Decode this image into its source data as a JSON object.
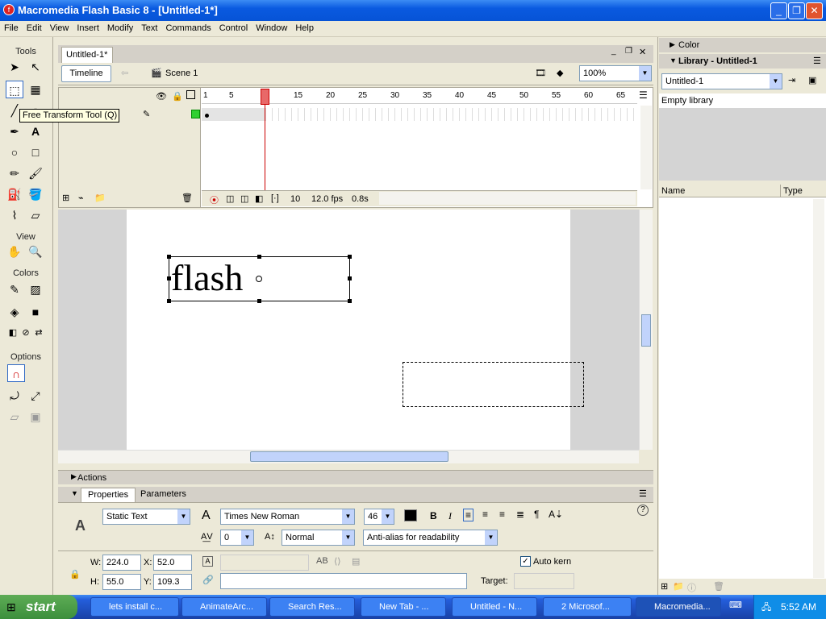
{
  "window": {
    "title": "Macromedia Flash Basic 8 - [Untitled-1*]"
  },
  "menu": [
    "File",
    "Edit",
    "View",
    "Insert",
    "Modify",
    "Text",
    "Commands",
    "Control",
    "Window",
    "Help"
  ],
  "toolbox": {
    "tools_label": "Tools",
    "view_label": "View",
    "colors_label": "Colors",
    "options_label": "Options",
    "tooltip": "Free Transform Tool (Q)"
  },
  "document": {
    "tab": "Untitled-1*",
    "timeline_button": "Timeline",
    "scene": "Scene 1",
    "zoom": "100%"
  },
  "timeline": {
    "frame_numbers": [
      "1",
      "5",
      "10",
      "15",
      "20",
      "25",
      "30",
      "35",
      "40",
      "45",
      "50",
      "55",
      "60",
      "65"
    ],
    "current_frame": "10",
    "fps": "12.0 fps",
    "time": "0.8s"
  },
  "stage": {
    "text": "flash"
  },
  "panels": {
    "actions": "Actions",
    "properties_tab": "Properties",
    "parameters_tab": "Parameters"
  },
  "properties": {
    "text_type": "Static Text",
    "font": "Times New Roman",
    "size": "46",
    "spacing": "0",
    "position": "Normal",
    "antialias": "Anti-alias for readability",
    "w_label": "W:",
    "w": "224.0",
    "x_label": "X:",
    "x": "52.0",
    "h_label": "H:",
    "h": "55.0",
    "y_label": "Y:",
    "y": "109.3",
    "auto_kern": "Auto kern",
    "target_label": "Target:"
  },
  "right_panel": {
    "color": "Color",
    "library": "Library - Untitled-1",
    "library_select": "Untitled-1",
    "empty": "Empty library",
    "col_name": "Name",
    "col_type": "Type"
  },
  "taskbar": {
    "start": "start",
    "tasks": [
      "lets install c...",
      "AnimateArc...",
      "Search Res...",
      "New Tab - ...",
      "Untitled - N...",
      "2 Microsof...",
      "Macromedia..."
    ],
    "clock": "5:52 AM"
  }
}
